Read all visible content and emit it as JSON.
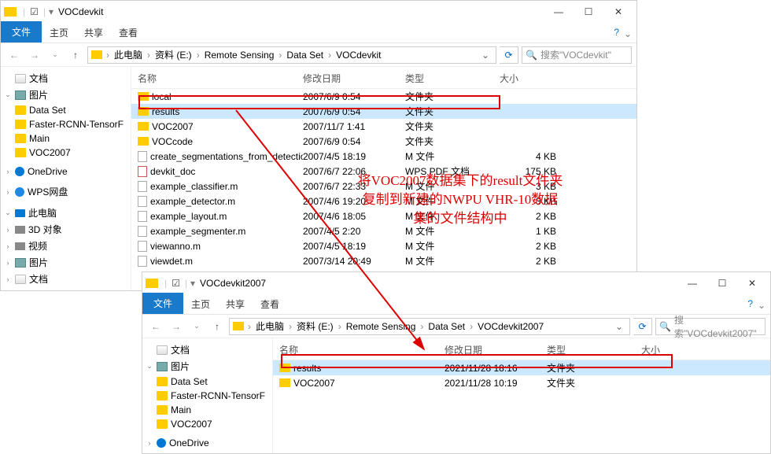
{
  "win1": {
    "title": "VOCdevkit",
    "tabs": {
      "file": "文件",
      "home": "主页",
      "share": "共享",
      "view": "查看"
    },
    "crumbs": [
      "此电脑",
      "资料 (E:)",
      "Remote Sensing",
      "Data Set",
      "VOCdevkit"
    ],
    "search_placeholder": "搜索\"VOCdevkit\"",
    "nav": {
      "docs": "文档",
      "pics": "图片",
      "dataset": "Data Set",
      "faster": "Faster-RCNN-TensorF",
      "main": "Main",
      "voc": "VOC2007",
      "onedrive": "OneDrive",
      "wps": "WPS网盘",
      "pc": "此电脑",
      "obj": "3D 对象",
      "video": "视频",
      "pics2": "图片",
      "docs2": "文档"
    },
    "columns": {
      "name": "名称",
      "date": "修改日期",
      "type": "类型",
      "size": "大小"
    },
    "rows": [
      {
        "name": "local",
        "date": "2007/6/9 0:54",
        "type": "文件夹",
        "size": "",
        "kind": "folder"
      },
      {
        "name": "results",
        "date": "2007/6/9 0:54",
        "type": "文件夹",
        "size": "",
        "kind": "folder",
        "selected": true
      },
      {
        "name": "VOC2007",
        "date": "2007/11/7 1:41",
        "type": "文件夹",
        "size": "",
        "kind": "folder"
      },
      {
        "name": "VOCcode",
        "date": "2007/6/9 0:54",
        "type": "文件夹",
        "size": "",
        "kind": "folder"
      },
      {
        "name": "create_segmentations_from_detectio...",
        "date": "2007/4/5 18:19",
        "type": "M 文件",
        "size": "4 KB",
        "kind": "file"
      },
      {
        "name": "devkit_doc",
        "date": "2007/6/7 22:06",
        "type": "WPS PDF 文档",
        "size": "175 KB",
        "kind": "pdf"
      },
      {
        "name": "example_classifier.m",
        "date": "2007/6/7 22:33",
        "type": "M 文件",
        "size": "3 KB",
        "kind": "file"
      },
      {
        "name": "example_detector.m",
        "date": "2007/4/6 19:20",
        "type": "M 文件",
        "size": "3 KB",
        "kind": "file"
      },
      {
        "name": "example_layout.m",
        "date": "2007/4/6 18:05",
        "type": "M 文件",
        "size": "2 KB",
        "kind": "file"
      },
      {
        "name": "example_segmenter.m",
        "date": "2007/4/5 2:20",
        "type": "M 文件",
        "size": "1 KB",
        "kind": "file"
      },
      {
        "name": "viewanno.m",
        "date": "2007/4/5 18:19",
        "type": "M 文件",
        "size": "2 KB",
        "kind": "file"
      },
      {
        "name": "viewdet.m",
        "date": "2007/3/14 20:49",
        "type": "M 文件",
        "size": "2 KB",
        "kind": "file"
      }
    ]
  },
  "win2": {
    "title": "VOCdevkit2007",
    "tabs": {
      "file": "文件",
      "home": "主页",
      "share": "共享",
      "view": "查看"
    },
    "crumbs": [
      "此电脑",
      "资料 (E:)",
      "Remote Sensing",
      "Data Set",
      "VOCdevkit2007"
    ],
    "search_placeholder": "搜索\"VOCdevkit2007\"",
    "nav": {
      "docs": "文档",
      "pics": "图片",
      "dataset": "Data Set",
      "faster": "Faster-RCNN-TensorF",
      "main": "Main",
      "voc": "VOC2007",
      "onedrive": "OneDrive"
    },
    "columns": {
      "name": "名称",
      "date": "修改日期",
      "type": "类型",
      "size": "大小"
    },
    "rows": [
      {
        "name": "results",
        "date": "2021/11/28 18:16",
        "type": "文件夹",
        "size": "",
        "kind": "folder",
        "selected": true
      },
      {
        "name": "VOC2007",
        "date": "2021/11/28 10:19",
        "type": "文件夹",
        "size": "",
        "kind": "folder"
      }
    ]
  },
  "annotation": {
    "l1": "将VOC2007数据集下的result文件夹",
    "l2": "复制到新建的NWPU VHR-10数据",
    "l3": "集的文件结构中"
  }
}
